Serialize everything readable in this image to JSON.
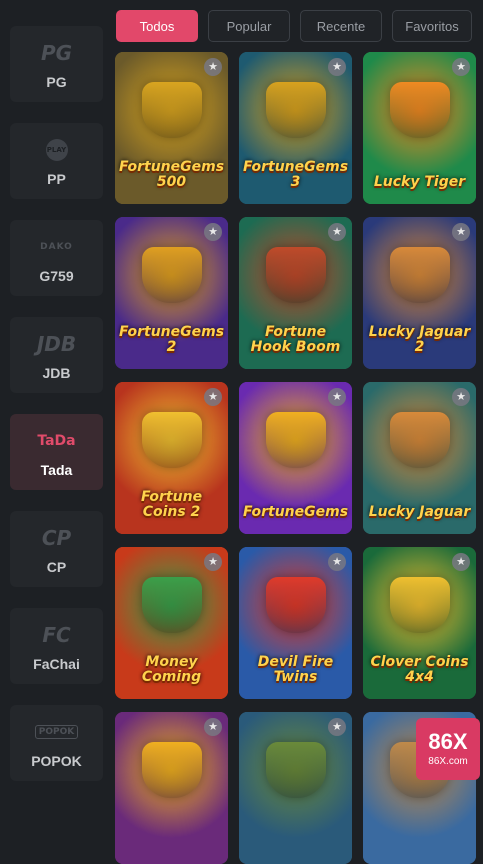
{
  "tabs": [
    {
      "label": "Todos",
      "active": true
    },
    {
      "label": "Popular",
      "active": false
    },
    {
      "label": "Recente",
      "active": false
    },
    {
      "label": "Favoritos",
      "active": false
    }
  ],
  "providers": [
    {
      "logo": "PG",
      "label": "PG",
      "active": false
    },
    {
      "logo": "PLAY",
      "label": "PP",
      "active": false
    },
    {
      "logo": "DAKO",
      "label": "G759",
      "active": false
    },
    {
      "logo": "JDB",
      "label": "JDB",
      "active": false
    },
    {
      "logo": "TaDa",
      "label": "Tada",
      "active": true
    },
    {
      "logo": "CP",
      "label": "CP",
      "active": false
    },
    {
      "logo": "FC",
      "label": "FaChai",
      "active": false
    },
    {
      "logo": "POPOK",
      "label": "POPOK",
      "active": false
    }
  ],
  "games": [
    {
      "title": "FortuneGems 500",
      "bg": "#6b5a2a",
      "accent": "#d9a520"
    },
    {
      "title": "FortuneGems 3",
      "bg": "#1e5a70",
      "accent": "#d8a21e"
    },
    {
      "title": "Lucky Tiger",
      "bg": "#1f8a4a",
      "accent": "#f08a22"
    },
    {
      "title": "FortuneGems 2",
      "bg": "#4a2a8a",
      "accent": "#e0a020"
    },
    {
      "title": "Fortune Hook Boom",
      "bg": "#1d6b52",
      "accent": "#c04a2a"
    },
    {
      "title": "Lucky Jaguar 2",
      "bg": "#2a3a7a",
      "accent": "#d88a3a"
    },
    {
      "title": "Fortune Coins 2",
      "bg": "#b8341e",
      "accent": "#f0c030"
    },
    {
      "title": "FortuneGems",
      "bg": "#6a2ab0",
      "accent": "#f0b020"
    },
    {
      "title": "Lucky Jaguar",
      "bg": "#2a6a6a",
      "accent": "#d88a3a"
    },
    {
      "title": "Money Coming",
      "bg": "#c83a1a",
      "accent": "#3aa04a"
    },
    {
      "title": "Devil Fire Twins",
      "bg": "#2a5aa8",
      "accent": "#e03a2a"
    },
    {
      "title": "Clover Coins 4x4",
      "bg": "#1a6a3a",
      "accent": "#f0c030"
    },
    {
      "title": "",
      "bg": "#6a2a7a",
      "accent": "#f0b020"
    },
    {
      "title": "",
      "bg": "#2a5a7a",
      "accent": "#6a8a3a"
    },
    {
      "title": "",
      "bg": "#3a6aa0",
      "accent": "#c08a4a"
    }
  ],
  "watermark": {
    "main": "86X",
    "sub": "86X.com"
  }
}
